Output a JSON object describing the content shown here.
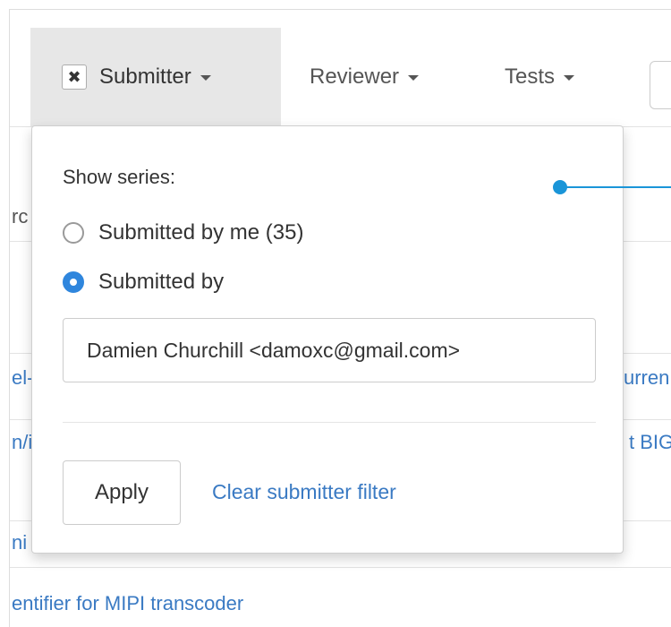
{
  "navbar": {
    "submitter_label": "Submitter",
    "reviewer_label": "Reviewer",
    "tests_label": "Tests",
    "clear_icon_glyph": "✖"
  },
  "dropdown": {
    "heading": "Show series:",
    "options": [
      {
        "label": "Submitted by me (35)",
        "selected": false
      },
      {
        "label": "Submitted by",
        "selected": true
      }
    ],
    "submitter_value": "Damien Churchill <damoxc@gmail.com>",
    "apply_label": "Apply",
    "clear_label": "Clear submitter filter"
  },
  "background_rows": [
    {
      "left": "rc",
      "right": ""
    },
    {
      "left": "el-",
      "right": "urren"
    },
    {
      "left": "n/i",
      "right": "t BIG"
    },
    {
      "left": "ni",
      "right": ""
    },
    {
      "left": "entifier for MIPI transcoder",
      "right": ""
    }
  ],
  "colors": {
    "link": "#3a7ac3",
    "radio_selected": "#2f86dd",
    "active_nav_bg": "#e7e7e7",
    "callout": "#1a95d8"
  }
}
